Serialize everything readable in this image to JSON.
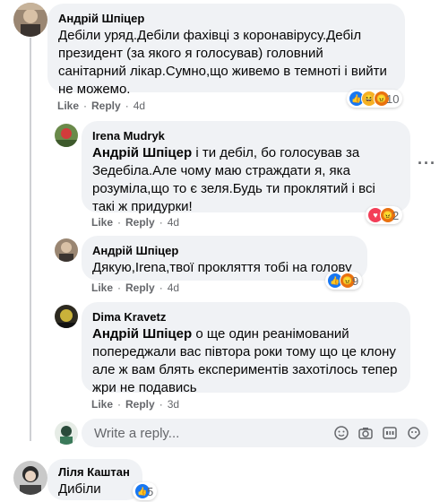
{
  "comments": [
    {
      "author": "Андрій Шпіцер",
      "mention": "",
      "text": "Дебіли уряд.Дебіли фахівці з коронавірусу.Дебіл президент (за якого я голосував) головний санітарний лікар.Сумно,що живемо в темноті і вийти не можемо.",
      "like": "Like",
      "reply": "Reply",
      "time": "4d",
      "reactions_count": "10"
    },
    {
      "author": "Irena Mudryk",
      "mention": "Андрій Шпіцер",
      "text": " і ти дебіл, бо голосував за Зедебіла.Але чому маю страждати я, яка розуміла,що то є зеля.Будь ти проклятий і всі такі ж придурки!",
      "like": "Like",
      "reply": "Reply",
      "time": "4d",
      "reactions_count": "2"
    },
    {
      "author": "Андрій Шпіцер",
      "mention": "",
      "text": "Дякую,Irena,твої прокляття тобі на голову",
      "like": "Like",
      "reply": "Reply",
      "time": "4d",
      "reactions_count": "9"
    },
    {
      "author": "Dima Kravetz",
      "mention": "Андрій Шпіцер",
      "text": " о ще один реанімований попереджали вас півтора роки тому що це клону але ж вам блять експериментів захотілось тепер жри не подавись",
      "like": "Like",
      "reply": "Reply",
      "time": "3d",
      "reactions_count": ""
    },
    {
      "author": "Ліля Каштан",
      "mention": "",
      "text": "Дибіли",
      "reactions_count": "5"
    }
  ],
  "reply_box": {
    "placeholder": "Write a reply..."
  },
  "sep": "·",
  "more": "···",
  "colors": {
    "bubble": "#f0f2f5",
    "meta": "#65676b",
    "like": "#1877f2",
    "love": "#f33e58",
    "haha": "#f7b125",
    "angry": "#e9710f"
  }
}
